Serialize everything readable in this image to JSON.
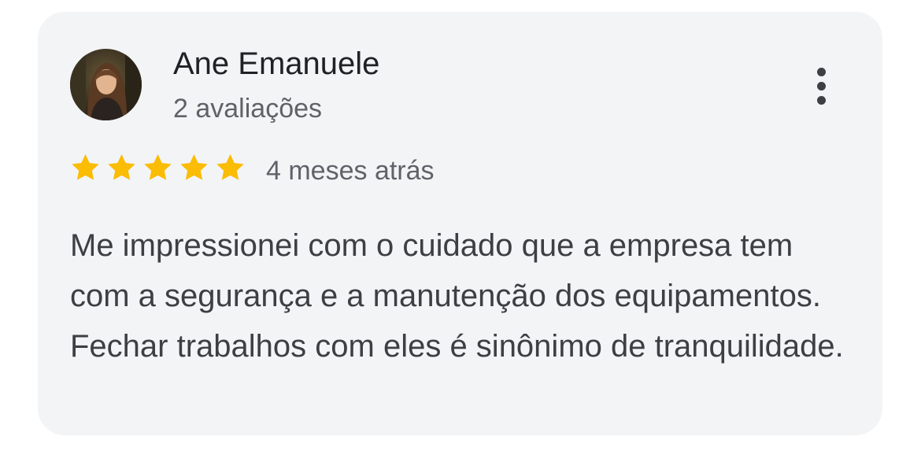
{
  "review": {
    "author_name": "Ane Emanuele",
    "author_reviews": "2 avaliações",
    "avatar_icon": "user-photo-icon",
    "more_icon": "more-vert-icon",
    "rating": 5,
    "rating_max": 5,
    "star_color": "#fbbc04",
    "time": "4 meses atrás",
    "text": "Me impressionei com o cuidado que a empresa tem com a segurança e a manutenção dos equipamentos. Fechar trabalhos com eles é sinônimo de tranquilidade."
  }
}
